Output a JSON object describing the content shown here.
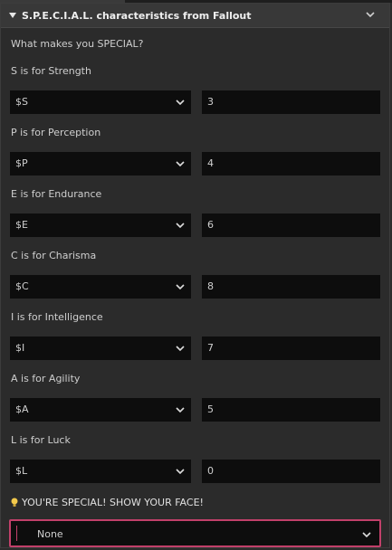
{
  "panel": {
    "title": "S.P.E.C.I.A.L. characteristics from Fallout",
    "question": "What makes you SPECIAL?"
  },
  "stats": [
    {
      "label": "S is for Strength",
      "variable": "$S",
      "value": "3"
    },
    {
      "label": "P is for Perception",
      "variable": "$P",
      "value": "4"
    },
    {
      "label": "E is for Endurance",
      "variable": "$E",
      "value": "6"
    },
    {
      "label": "C is for Charisma",
      "variable": "$C",
      "value": "8"
    },
    {
      "label": "I is for Intelligence",
      "variable": "$I",
      "value": "7"
    },
    {
      "label": "A is for Agility",
      "variable": "$A",
      "value": "5"
    },
    {
      "label": "L is for Luck",
      "variable": "$L",
      "value": "0"
    }
  ],
  "face": {
    "icon": "lightbulb-icon",
    "label": "YOU'RE SPECIAL! SHOW YOUR FACE!",
    "selected": "None"
  },
  "colors": {
    "background": "#2b2b2b",
    "header": "#383838",
    "field": "#0d0d0d",
    "focus_border": "#c1406a",
    "bulb": "#f2c94c"
  }
}
